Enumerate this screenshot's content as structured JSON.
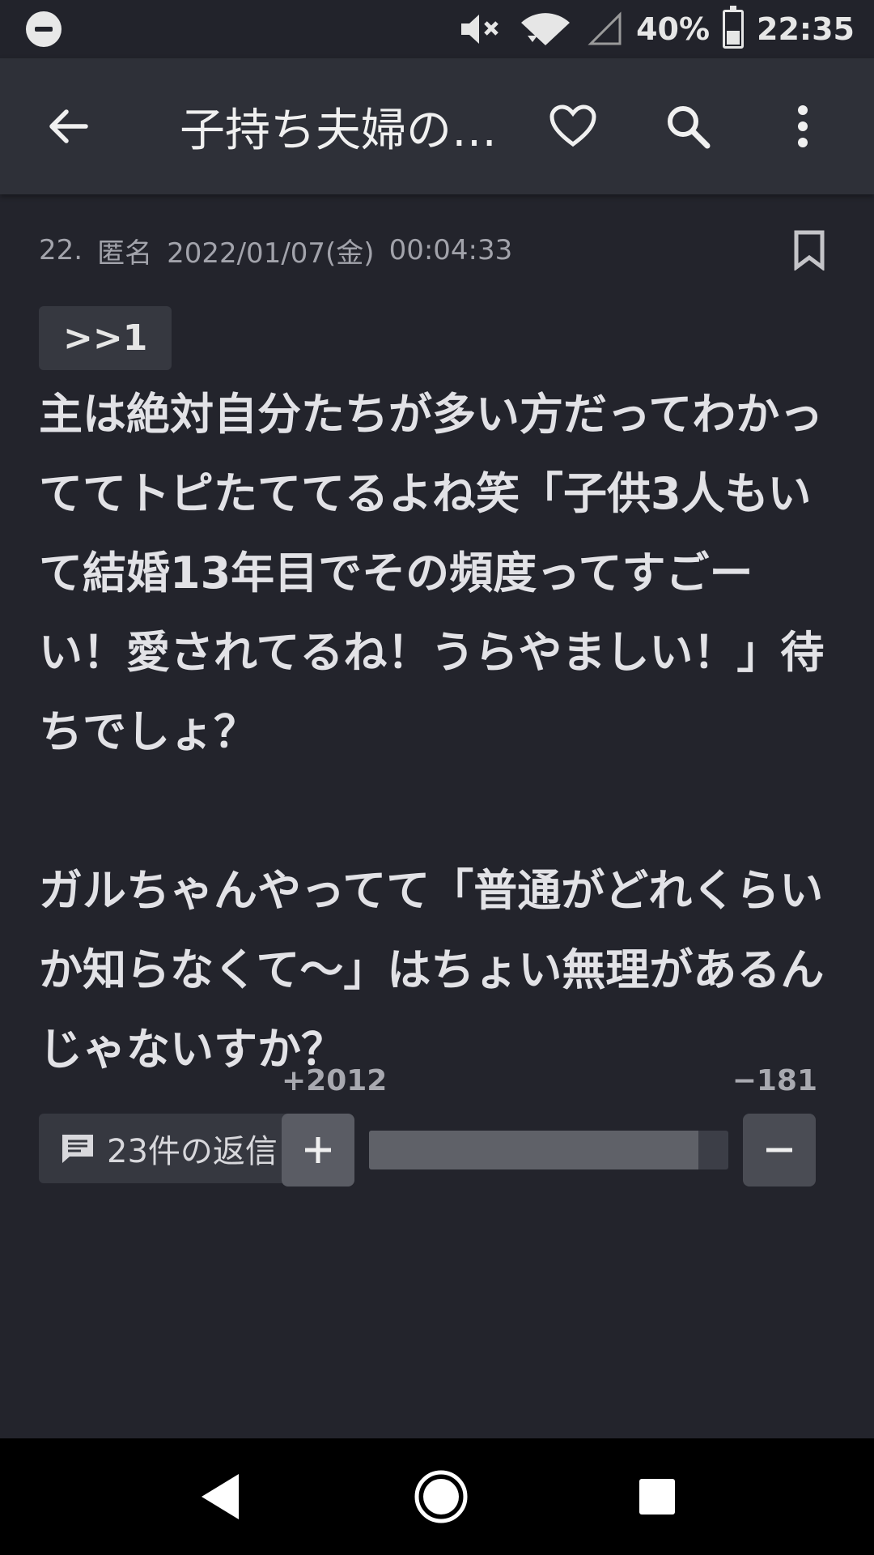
{
  "status_bar": {
    "battery": "40%",
    "time": "22:35",
    "icons": [
      "dnd-icon",
      "mute-icon",
      "wifi-icon",
      "signal-icon",
      "battery-icon"
    ]
  },
  "app_bar": {
    "title": "子持ち夫婦の…",
    "icons": [
      "back-arrow-icon",
      "heart-icon",
      "search-icon",
      "more-vert-icon"
    ]
  },
  "post": {
    "number": "22.",
    "author": "匿名",
    "date": "2022/01/07(金)",
    "time": "00:04:33",
    "anchor": ">>1",
    "body": "主は絶対自分たちが多い方だってわかっててトピたててるよね笑「子供3人もいて結婚13年目でその頻度ってすごーい！愛されてるね！うらやましい！」待ちでしょ？\n\nガルちゃんやってて「普通がどれくらいか知らなくて〜」はちょい無理があるんじゃないすか？",
    "replies_label": "23件の返信"
  },
  "votes": {
    "plus": "+2012",
    "minus": "−181",
    "plus_ratio": 0.917
  },
  "colors": {
    "background": "#23242c",
    "app_bar": "#2e3038",
    "chip": "#363840"
  }
}
